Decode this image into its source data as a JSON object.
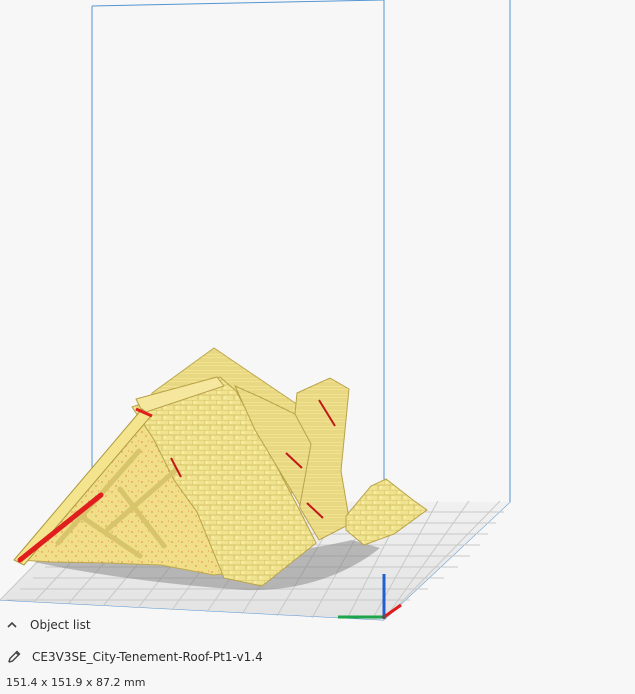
{
  "app": {
    "object_list_label": "Object list",
    "object_name": "CE3V3SE_City-Tenement-Roof-Pt1-v1.4",
    "dimensions": "151.4 x 151.9 x 87.2 mm"
  },
  "icons": {
    "toggle_icon": "chevron-up-icon",
    "edit_icon": "pencil-icon"
  },
  "colors": {
    "model": "#efe089",
    "model_shadow": "#c8b24e",
    "build_volume_lines": "#4a8fd0",
    "grid": "#c8c8c8",
    "plate": "#e6e6e6",
    "axis_x": "#e01b1b",
    "axis_y": "#1ea44a",
    "axis_z": "#1f5fd0",
    "seam_red": "#d61818"
  }
}
